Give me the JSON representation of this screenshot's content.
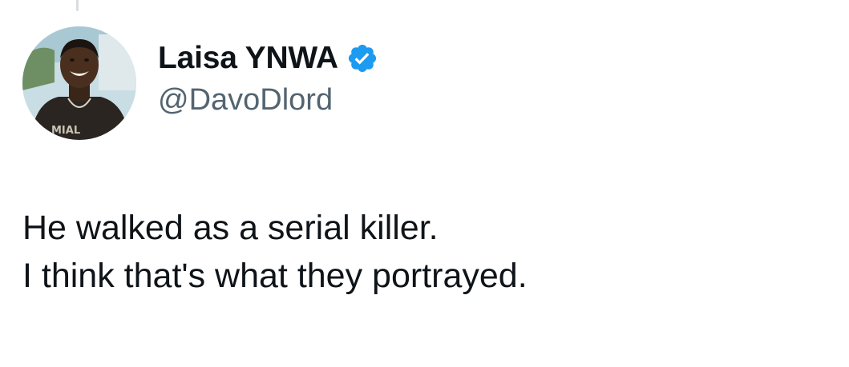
{
  "tweet": {
    "author": {
      "display_name": "Laisa YNWA",
      "handle": "@DavoDlord",
      "verified": true,
      "avatar_icon": "profile-photo"
    },
    "text_lines": [
      "He walked as a serial killer.",
      "I think that's what they portrayed."
    ]
  },
  "colors": {
    "verified_badge": "#1d9bf0",
    "text_primary": "#0f1419",
    "text_secondary": "#536471",
    "background": "#ffffff"
  }
}
